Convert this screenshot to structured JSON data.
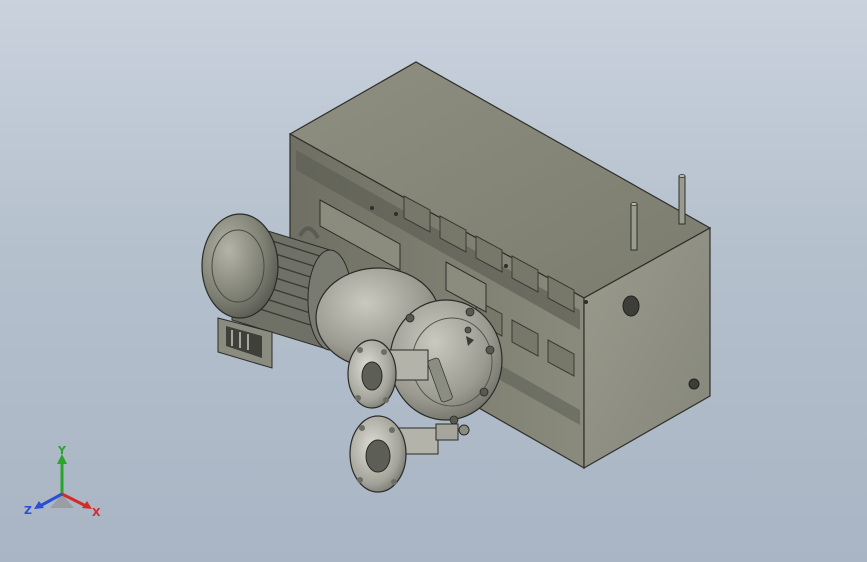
{
  "triad": {
    "x_label": "X",
    "y_label": "Y",
    "z_label": "Z",
    "colors": {
      "x": "#d42a2a",
      "y": "#2aa52a",
      "z": "#2a4fd4"
    }
  },
  "icons": [
    "coordinate-triad-icon"
  ]
}
